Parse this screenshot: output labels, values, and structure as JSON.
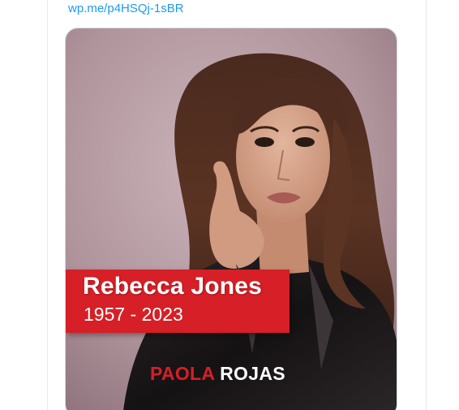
{
  "tweet": {
    "link_text": "wp.me/p4HSQj-1sBR"
  },
  "media": {
    "banner": {
      "name": "Rebecca Jones",
      "years": "1957 - 2023"
    },
    "brand": {
      "first": "PAOLA",
      "last": " ROJAS"
    },
    "colors": {
      "banner_red": "#d61f26",
      "link_blue": "#1d9bf0",
      "background_mauve": "#b79aa3",
      "jacket_black": "#1a1718"
    }
  }
}
